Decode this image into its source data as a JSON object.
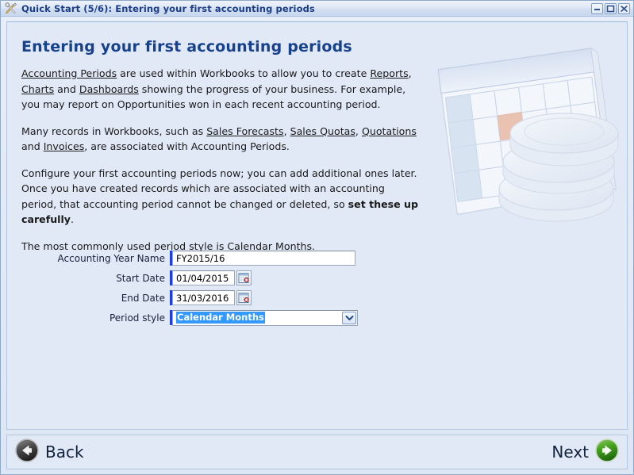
{
  "window": {
    "title": "Quick Start (5/6): Entering your first accounting periods",
    "icon": "tools-icon",
    "buttons": {
      "minimize": "minimize-icon",
      "maximize": "maximize-icon",
      "close": "close-icon"
    }
  },
  "page": {
    "heading": "Entering your first accounting periods",
    "illustration": "calendar-and-coins-illustration",
    "paragraphs": [
      {
        "id": "p1",
        "parts": [
          {
            "text": "Accounting Periods",
            "link": true
          },
          {
            "text": " are used within Workbooks to allow you to create ",
            "link": false
          },
          {
            "text": "Reports",
            "link": true
          },
          {
            "text": ", ",
            "link": false
          },
          {
            "text": "Charts",
            "link": true
          },
          {
            "text": " and ",
            "link": false
          },
          {
            "text": "Dashboards",
            "link": true
          },
          {
            "text": " showing the progress of your business. For example, you may report on Opportunities won in each recent accounting period.",
            "link": false
          }
        ]
      },
      {
        "id": "p2",
        "parts": [
          {
            "text": "Many records in Workbooks, such as ",
            "link": false
          },
          {
            "text": "Sales Forecasts",
            "link": true
          },
          {
            "text": ", ",
            "link": false
          },
          {
            "text": "Sales Quotas",
            "link": true
          },
          {
            "text": ", ",
            "link": false
          },
          {
            "text": "Quotations",
            "link": true
          },
          {
            "text": " and ",
            "link": false
          },
          {
            "text": "Invoices",
            "link": true
          },
          {
            "text": ", are associated with Accounting Periods.",
            "link": false
          }
        ]
      },
      {
        "id": "p3",
        "parts": [
          {
            "text": "Configure your first accounting periods now; you can add additional ones later. Once you have created records which are associated with an accounting period, that accounting period cannot be changed or deleted, so ",
            "link": false
          },
          {
            "text": "set these up carefully",
            "link": false,
            "bold": true
          },
          {
            "text": ".",
            "link": false
          }
        ]
      },
      {
        "id": "p4",
        "parts": [
          {
            "text": "The most commonly used period style is Calendar Months.",
            "link": false
          }
        ]
      }
    ]
  },
  "form": {
    "fields": [
      {
        "name": "accounting-year-name",
        "label": "Accounting Year Name",
        "value": "FY2015/16",
        "placeholder": "",
        "type": "text",
        "required": true
      },
      {
        "name": "start-date",
        "label": "Start Date",
        "value": "01/04/2015",
        "placeholder": "",
        "type": "date",
        "required": true,
        "picker_icon": "calendar-icon"
      },
      {
        "name": "end-date",
        "label": "End Date",
        "value": "31/03/2016",
        "placeholder": "",
        "type": "date",
        "required": true,
        "picker_icon": "calendar-icon"
      },
      {
        "name": "period-style",
        "label": "Period style",
        "value": "Calendar Months",
        "type": "select",
        "required": true,
        "selected_highlighted": true
      }
    ]
  },
  "footer": {
    "back_label": "Back",
    "next_label": "Next"
  },
  "colors": {
    "window_bg": "#dfe8f6",
    "panel_bg": "#e1e9f7",
    "title_text": "#1b3f86",
    "heading": "#17418b",
    "required_marker": "#1f3fd8",
    "selection_highlight": "#3399ff",
    "next_accent": "#3f9b1f",
    "back_accent": "#4a4a4a"
  }
}
